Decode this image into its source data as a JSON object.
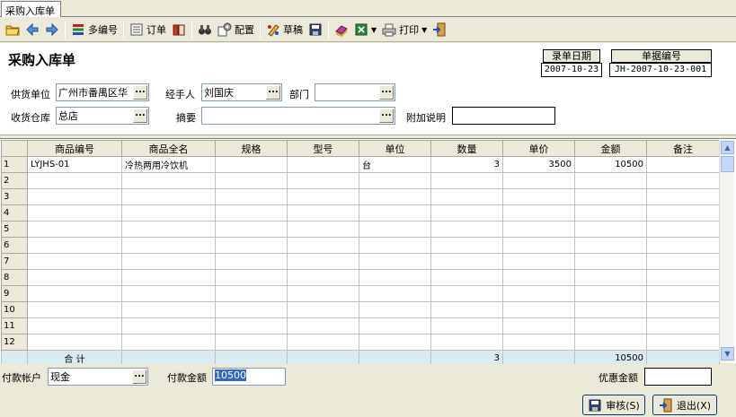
{
  "tab": {
    "label": "采购入库单"
  },
  "toolbar": {
    "multi_code": "多编号",
    "order": "订单",
    "config": "配置",
    "draft": "草稿",
    "print": "打印"
  },
  "form": {
    "title": "采购入库单",
    "entry_date_label": "录单日期",
    "entry_date_value": "2007-10-23",
    "doc_no_label": "单据编号",
    "doc_no_value": "JH-2007-10-23-001",
    "supplier_label": "供货单位",
    "supplier_value": "广州市番禺区华",
    "handler_label": "经手人",
    "handler_value": "刘国庆",
    "dept_label": "部门",
    "dept_value": "",
    "warehouse_label": "收货仓库",
    "warehouse_value": "总店",
    "summary_label": "摘要",
    "summary_value": "",
    "extra_label": "附加说明",
    "extra_value": "",
    "ellipsis": "..."
  },
  "grid": {
    "columns": [
      "商品编号",
      "商品全名",
      "规格",
      "型号",
      "单位",
      "数量",
      "单价",
      "金额",
      "备注"
    ],
    "rows": [
      [
        "1",
        "LYJHS-01",
        "冷热两用冷饮机",
        "",
        "",
        "台",
        "3",
        "3500",
        "10500",
        ""
      ],
      [
        "2",
        "",
        "",
        "",
        "",
        "",
        "",
        "",
        "",
        ""
      ],
      [
        "3",
        "",
        "",
        "",
        "",
        "",
        "",
        "",
        "",
        ""
      ],
      [
        "4",
        "",
        "",
        "",
        "",
        "",
        "",
        "",
        "",
        ""
      ],
      [
        "5",
        "",
        "",
        "",
        "",
        "",
        "",
        "",
        "",
        ""
      ],
      [
        "6",
        "",
        "",
        "",
        "",
        "",
        "",
        "",
        "",
        ""
      ],
      [
        "7",
        "",
        "",
        "",
        "",
        "",
        "",
        "",
        "",
        ""
      ],
      [
        "8",
        "",
        "",
        "",
        "",
        "",
        "",
        "",
        "",
        ""
      ],
      [
        "9",
        "",
        "",
        "",
        "",
        "",
        "",
        "",
        "",
        ""
      ],
      [
        "10",
        "",
        "",
        "",
        "",
        "",
        "",
        "",
        "",
        ""
      ],
      [
        "11",
        "",
        "",
        "",
        "",
        "",
        "",
        "",
        "",
        ""
      ],
      [
        "12",
        "",
        "",
        "",
        "",
        "",
        "",
        "",
        "",
        ""
      ]
    ],
    "total_label": "合   计",
    "total_qty": "3",
    "total_amount": "10500"
  },
  "footer": {
    "account_label": "付款帐户",
    "account_value": "现金",
    "pay_amount_label": "付款金额",
    "pay_amount_value": "10500",
    "discount_label": "优惠金额",
    "discount_value": "",
    "audit_button": "审核(S)",
    "exit_button": "退出(X)"
  }
}
